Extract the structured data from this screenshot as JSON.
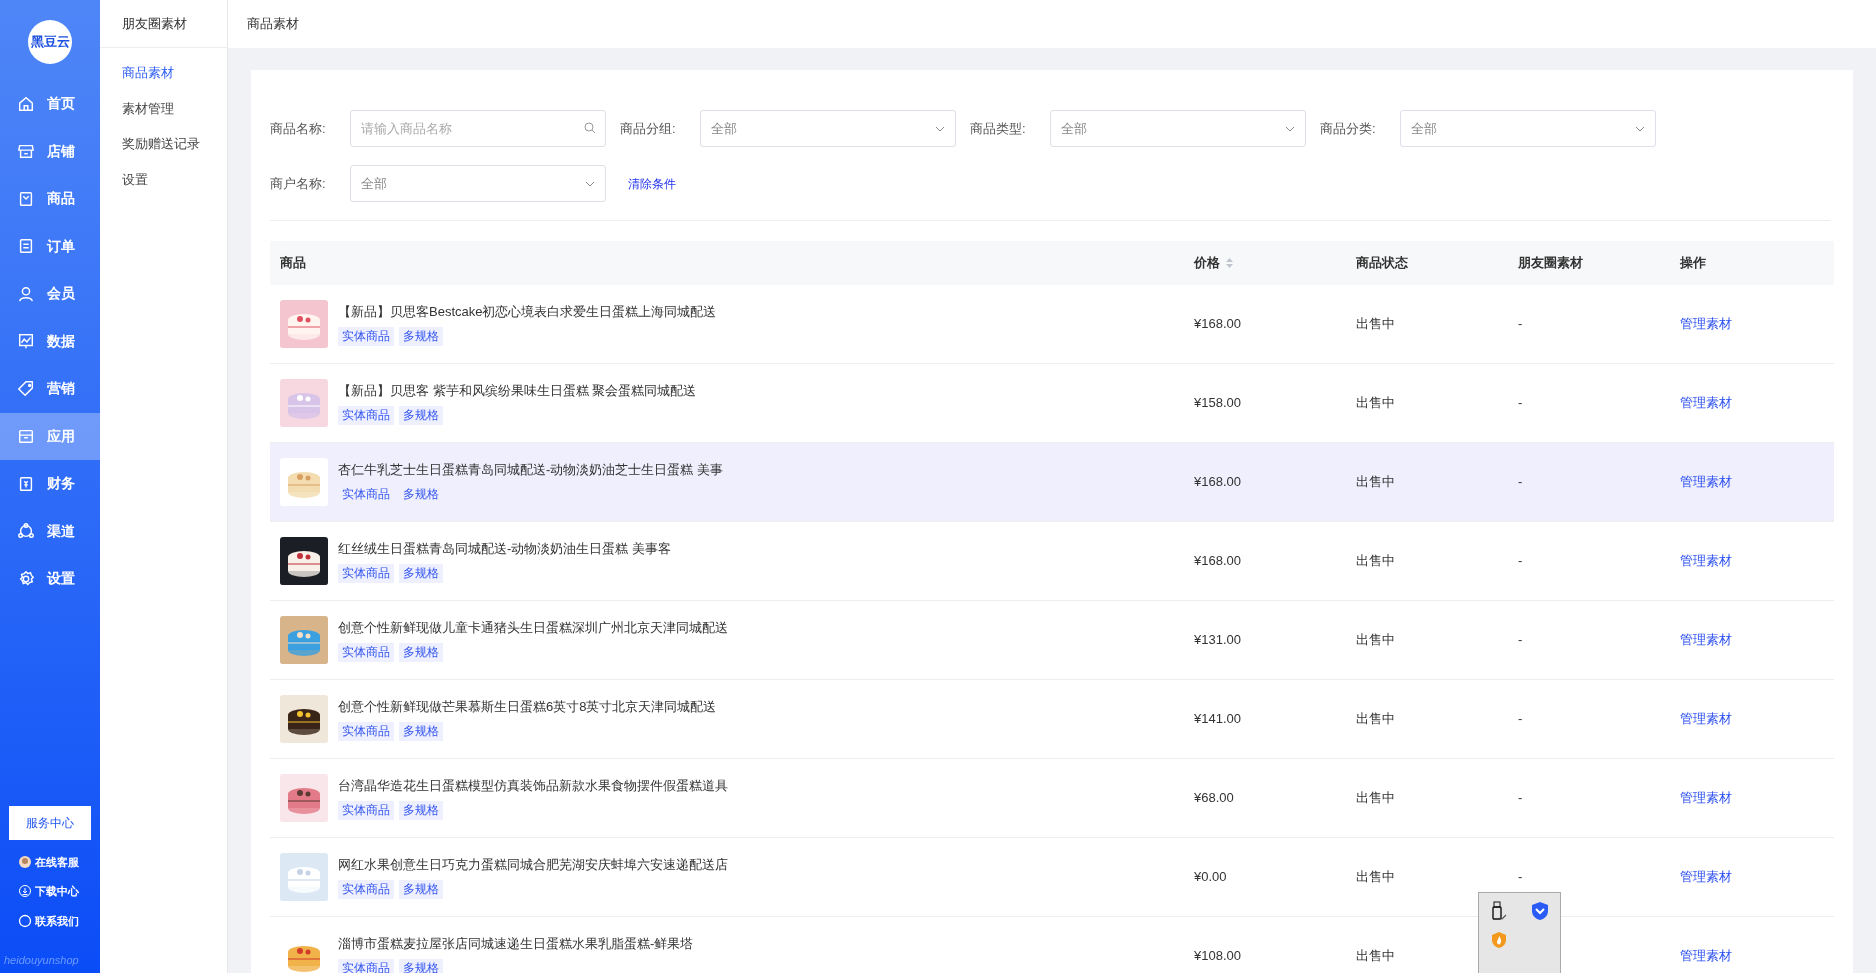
{
  "logo": {
    "text": "黑豆云"
  },
  "nav": [
    {
      "label": "首页",
      "selected": false
    },
    {
      "label": "店铺",
      "selected": false
    },
    {
      "label": "商品",
      "selected": false
    },
    {
      "label": "订单",
      "selected": false
    },
    {
      "label": "会员",
      "selected": false
    },
    {
      "label": "数据",
      "selected": false
    },
    {
      "label": "营销",
      "selected": false
    },
    {
      "label": "应用",
      "selected": true
    },
    {
      "label": "财务",
      "selected": false
    },
    {
      "label": "渠道",
      "selected": false
    },
    {
      "label": "设置",
      "selected": false
    }
  ],
  "service_button": "服务中心",
  "bottom_links": [
    "在线客服",
    "下载中心",
    "联系我们"
  ],
  "brand_footer": "heidouyunshop",
  "subnav": {
    "title": "朋友圈素材",
    "items": [
      {
        "label": "商品素材",
        "selected": true
      },
      {
        "label": "素材管理",
        "selected": false
      },
      {
        "label": "奖励赠送记录",
        "selected": false
      },
      {
        "label": "设置",
        "selected": false
      }
    ]
  },
  "breadcrumb": "商品素材",
  "filters": [
    {
      "label": "商品名称:",
      "kind": "search",
      "placeholder": "请输入商品名称"
    },
    {
      "label": "商品分组:",
      "kind": "select",
      "value": "全部"
    },
    {
      "label": "商品类型:",
      "kind": "select",
      "value": "全部"
    },
    {
      "label": "商品分类:",
      "kind": "select",
      "value": "全部"
    },
    {
      "label": "商户名称:",
      "kind": "select",
      "value": "全部"
    }
  ],
  "clear_link": "清除条件",
  "table": {
    "columns": [
      "商品",
      "价格",
      "商品状态",
      "朋友圈素材",
      "操作"
    ],
    "rows": [
      {
        "name": "【新品】贝思客Bestcake初恋心境表白求爱生日蛋糕上海同城配送",
        "tags": [
          "实体商品",
          "多规格"
        ],
        "price": "¥168.00",
        "status": "出售中",
        "material": "-",
        "action": "管理素材",
        "selected": false
      },
      {
        "name": "【新品】贝思客 紫芋和风缤纷果味生日蛋糕 聚会蛋糕同城配送",
        "tags": [
          "实体商品",
          "多规格"
        ],
        "price": "¥158.00",
        "status": "出售中",
        "material": "-",
        "action": "管理素材",
        "selected": false
      },
      {
        "name": "杏仁牛乳芝士生日蛋糕青岛同城配送-动物淡奶油芝士生日蛋糕 美事",
        "tags": [
          "实体商品",
          "多规格"
        ],
        "price": "¥168.00",
        "status": "出售中",
        "material": "-",
        "action": "管理素材",
        "selected": true
      },
      {
        "name": "红丝绒生日蛋糕青岛同城配送-动物淡奶油生日蛋糕 美事客",
        "tags": [
          "实体商品",
          "多规格"
        ],
        "price": "¥168.00",
        "status": "出售中",
        "material": "-",
        "action": "管理素材",
        "selected": false
      },
      {
        "name": "创意个性新鲜现做儿童卡通猪头生日蛋糕深圳广州北京天津同城配送",
        "tags": [
          "实体商品",
          "多规格"
        ],
        "price": "¥131.00",
        "status": "出售中",
        "material": "-",
        "action": "管理素材",
        "selected": false
      },
      {
        "name": "创意个性新鲜现做芒果慕斯生日蛋糕6英寸8英寸北京天津同城配送",
        "tags": [
          "实体商品",
          "多规格"
        ],
        "price": "¥141.00",
        "status": "出售中",
        "material": "-",
        "action": "管理素材",
        "selected": false
      },
      {
        "name": "台湾晶华造花生日蛋糕模型仿真装饰品新款水果食物摆件假蛋糕道具",
        "tags": [
          "实体商品",
          "多规格"
        ],
        "price": "¥68.00",
        "status": "出售中",
        "material": "-",
        "action": "管理素材",
        "selected": false
      },
      {
        "name": "网红水果创意生日巧克力蛋糕同城合肥芜湖安庆蚌埠六安速递配送店",
        "tags": [
          "实体商品",
          "多规格"
        ],
        "price": "¥0.00",
        "status": "出售中",
        "material": "-",
        "action": "管理素材",
        "selected": false
      },
      {
        "name": "淄博市蛋糕麦拉屋张店同城速递生日蛋糕水果乳脂蛋糕-鲜果塔",
        "tags": [
          "实体商品",
          "多规格"
        ],
        "price": "¥108.00",
        "status": "出售中",
        "action": "管理素材",
        "selected": false
      }
    ]
  }
}
